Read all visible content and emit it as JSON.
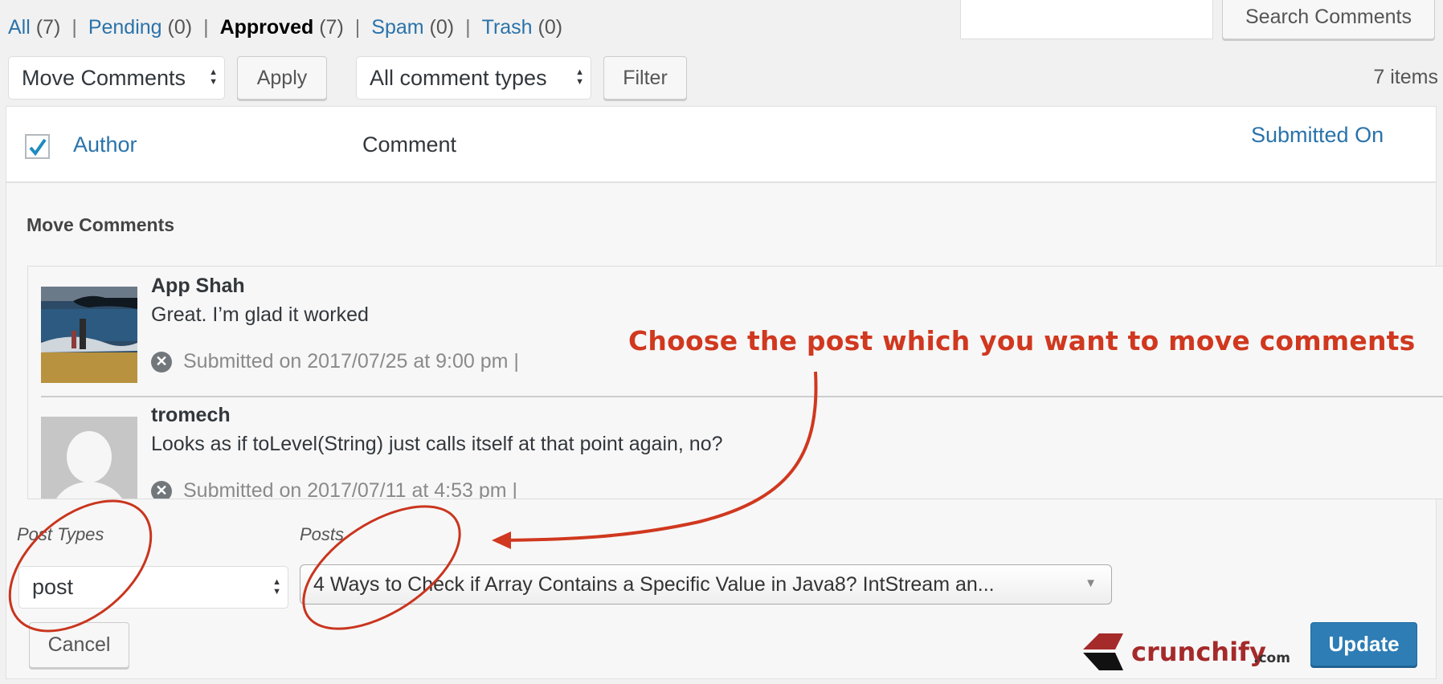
{
  "status_links": [
    {
      "label": "All",
      "count": "(7)",
      "current": false
    },
    {
      "label": "Pending",
      "count": "(0)",
      "current": false
    },
    {
      "label": "Approved",
      "count": "(7)",
      "current": true
    },
    {
      "label": "Spam",
      "count": "(0)",
      "current": false
    },
    {
      "label": "Trash",
      "count": "(0)",
      "current": false
    }
  ],
  "search": {
    "value": "",
    "button_label": "Search Comments"
  },
  "toolbar": {
    "bulk_action": "Move Comments",
    "apply_label": "Apply",
    "comment_type": "All comment types",
    "filter_label": "Filter",
    "items_count": "7 items"
  },
  "table": {
    "headers": {
      "author": "Author",
      "comment": "Comment",
      "submitted_on": "Submitted On"
    },
    "select_all_checked": true
  },
  "move_panel": {
    "title": "Move Comments",
    "comments": [
      {
        "author": "App Shah",
        "text": "Great. I’m glad it worked",
        "meta": "Submitted on 2017/07/25 at 9:00 pm |",
        "avatar": "beach-photo"
      },
      {
        "author": "tromech",
        "text": "Looks as if toLevel(String) just calls itself at that point again, no?",
        "meta": "Submitted on 2017/07/11 at 4:53 pm |",
        "avatar": "default-avatar"
      }
    ],
    "post_types_label": "Post Types",
    "post_type_value": "post",
    "posts_label": "Posts",
    "posts_value": "4 Ways to Check if Array Contains a Specific Value in Java8? IntStream an...",
    "cancel_label": "Cancel",
    "update_label": "Update"
  },
  "annotation": {
    "text": "Choose the post which you want to move comments",
    "color": "#d0381f"
  },
  "logo": {
    "name": "crunchify",
    "suffix": ".com",
    "brand_color": "#a52a2a"
  },
  "colors": {
    "link": "#2a73aa",
    "primary_button": "#2e7db5"
  }
}
